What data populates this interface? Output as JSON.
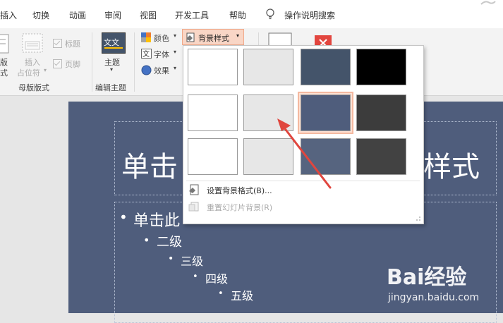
{
  "menu_tabs": [
    "插入",
    "切换",
    "动画",
    "审阅",
    "视图",
    "开发工具",
    "帮助"
  ],
  "tell_me": "操作说明搜索",
  "ribbon": {
    "layout_label_1": "版",
    "layout_label_2": "式",
    "insert_placeholder_1": "插入",
    "insert_placeholder_2": "占位符",
    "checkbox_title": "标题",
    "checkbox_footer": "页脚",
    "group_master_layout": "母版版式",
    "theme_label": "主题",
    "theme_icon_text": "文文",
    "group_edit_theme": "编辑主题",
    "colors": "颜色",
    "fonts": "字体",
    "effects": "效果",
    "background_styles": "背景样式"
  },
  "slide": {
    "title_left": "单击",
    "title_right": "样式",
    "level1": "单击此",
    "level2": "二级",
    "level3": "三级",
    "level4": "四级",
    "level5": "五级"
  },
  "dropdown": {
    "swatches": [
      [
        "#ffffff",
        "#e7e7e7",
        "#44546a",
        "#000000"
      ],
      [
        "#ffffff",
        "#e7e7e7",
        "#4f5d7c",
        "#3c3c3c"
      ],
      [
        "#ffffff",
        "#e7e7e7",
        "#56647f",
        "#424242"
      ]
    ],
    "selected": {
      "row": 1,
      "col": 2
    },
    "format_background": "设置背景格式(B)...",
    "reset_background": "重置幻灯片背景(R)"
  },
  "watermark": {
    "brand": "Bai经验",
    "url": "jingyan.baidu.com"
  },
  "colors": {
    "accent_red": "#e2463f",
    "arrow": "#e0463e",
    "slide_bg": "#4f5d7c"
  }
}
